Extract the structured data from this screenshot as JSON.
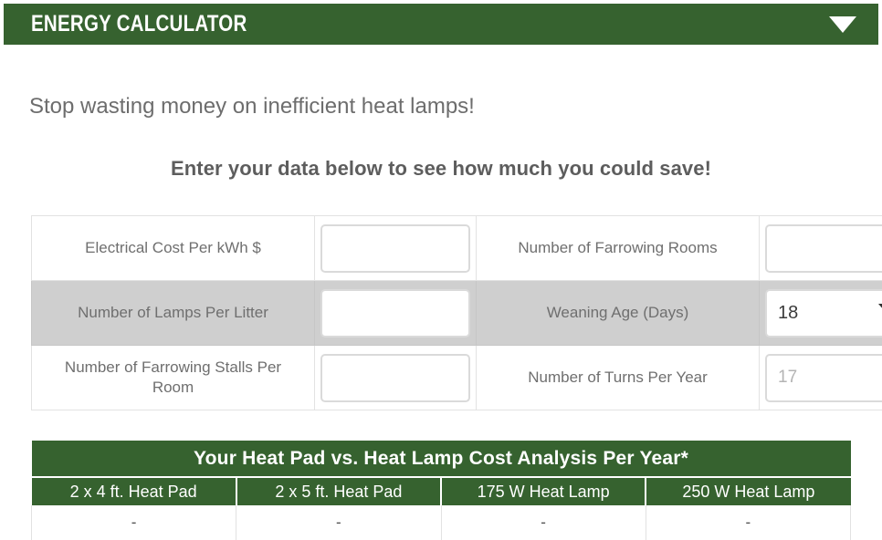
{
  "widget": {
    "title": "Energy Calculator",
    "toggle_icon": "chevron-down-icon"
  },
  "intro": {
    "lead": "Stop wasting money on inefficient heat lamps!",
    "subheading": "Enter your data below to see how much you could save!"
  },
  "form": {
    "rows": [
      {
        "left_label": "Electrical Cost Per kWh $",
        "left_value": "",
        "left_placeholder": "",
        "left_type": "text",
        "right_label": "Number of Farrowing Rooms",
        "right_value": "",
        "right_placeholder": "",
        "right_type": "text",
        "striped": false
      },
      {
        "left_label": "Number of Lamps Per Litter",
        "left_value": "",
        "left_placeholder": "",
        "left_type": "text",
        "right_label": "Weaning Age (Days)",
        "right_value": "18",
        "right_placeholder": "",
        "right_type": "select",
        "striped": true
      },
      {
        "left_label": "Number of Farrowing Stalls Per Room",
        "left_value": "",
        "left_placeholder": "",
        "left_type": "text",
        "right_label": "Number of Turns Per Year",
        "right_value": "",
        "right_placeholder": "17",
        "right_type": "text",
        "striped": false
      }
    ]
  },
  "results": {
    "title": "Your Heat Pad vs. Heat Lamp Cost Analysis Per Year*",
    "columns": [
      "2 x 4 ft. Heat Pad",
      "2 x 5 ft. Heat Pad",
      "175 W Heat Lamp",
      "250 W Heat Lamp"
    ],
    "values": [
      "-",
      "-",
      "-",
      "-"
    ]
  },
  "colors": {
    "brand_green": "#36622f",
    "striped_row": "#cfcfcf",
    "label_text": "#6f6f6f",
    "border": "#e2e2e2"
  }
}
